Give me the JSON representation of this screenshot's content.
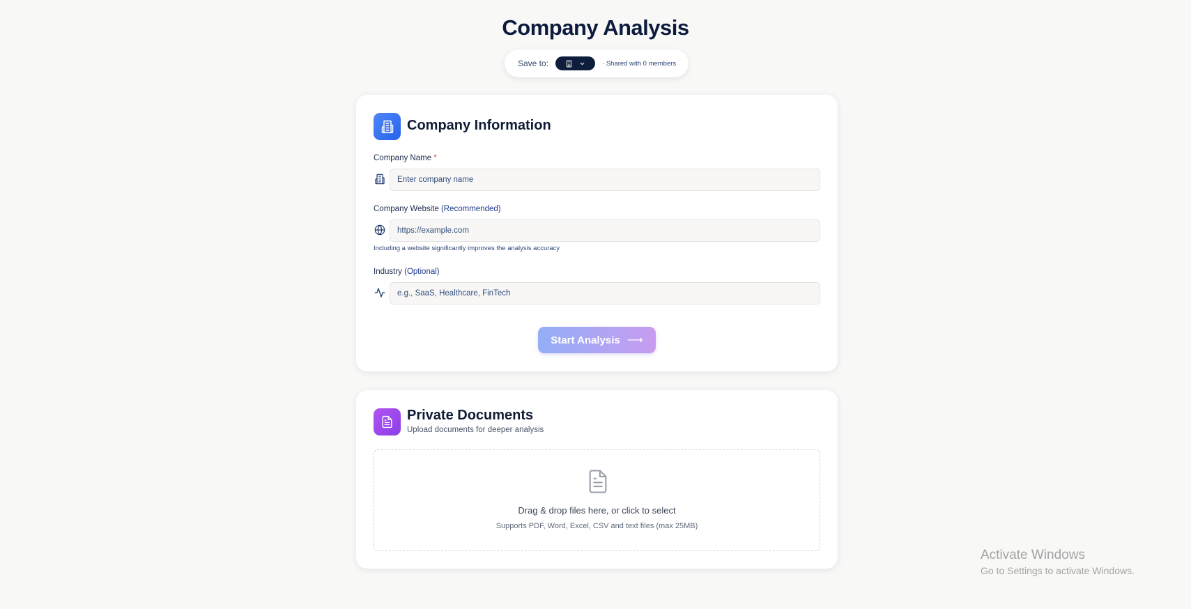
{
  "header": {
    "title": "Company Analysis",
    "save_label": "Save to:",
    "shared_text": "· Shared with 0 members"
  },
  "company_info": {
    "title": "Company Information",
    "company_name": {
      "label": "Company Name",
      "required_mark": "*",
      "placeholder": "Enter company name",
      "value": ""
    },
    "website": {
      "label": "Company Website",
      "label_note": "(Recommended)",
      "placeholder": "https://example.com",
      "value": "",
      "hint": "Including a website significantly improves the analysis accuracy"
    },
    "industry": {
      "label": "Industry",
      "label_note": "(Optional)",
      "placeholder": "e.g., SaaS, Healthcare, FinTech",
      "value": ""
    },
    "start_button": {
      "label": "Start Analysis",
      "arrow": "⟶",
      "disabled": true
    }
  },
  "private_documents": {
    "title": "Private Documents",
    "subtitle": "Upload documents for deeper analysis",
    "dropzone_text": "Drag & drop files here, or click to select",
    "dropzone_subtext": "Supports PDF, Word, Excel, CSV and text files (max 25MB)"
  },
  "watermark": {
    "title": "Activate Windows",
    "subtitle": "Go to Settings to activate Windows."
  },
  "icons": {
    "building": "building-icon",
    "globe": "globe-icon",
    "activity": "activity-icon",
    "document": "document-icon",
    "chevron": "chevron-down-icon"
  },
  "colors": {
    "background": "#f8f8f7",
    "title": "#0d1b3e",
    "accent_blue": "#2563eb",
    "accent_purple": "#8b3ee8",
    "button_gradient_start": "#93aef6",
    "button_gradient_end": "#c79cf1",
    "selector_bg": "#0f1d3c",
    "required": "#e53e3e"
  }
}
